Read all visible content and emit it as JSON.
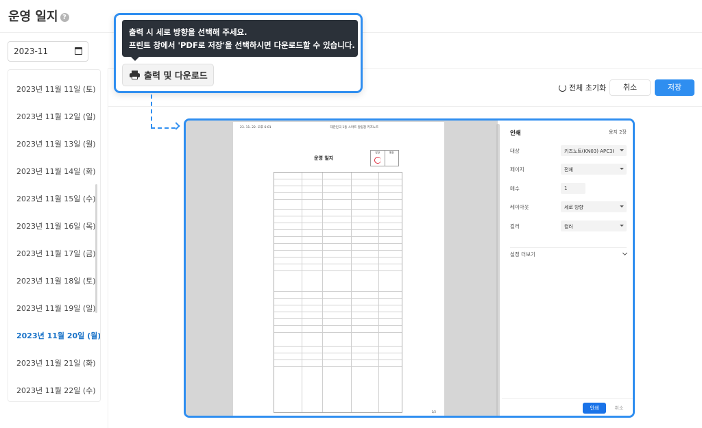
{
  "header": {
    "title": "운영 일지",
    "help_icon": "question-circle-icon"
  },
  "month_picker": {
    "value": "2023-11",
    "icon": "calendar-icon"
  },
  "date_list": {
    "items": [
      "2023년 11월 11일 (토)",
      "2023년 11월 12일 (일)",
      "2023년 11월 13일 (월)",
      "2023년 11월 14일 (화)",
      "2023년 11월 15일 (수)",
      "2023년 11월 16일 (목)",
      "2023년 11월 17일 (금)",
      "2023년 11월 18일 (토)",
      "2023년 11월 19일 (일)",
      "2023년 11월 20일 (월)",
      "2023년 11월 21일 (화)",
      "2023년 11월 22일 (수)"
    ],
    "active": "2023년 11월 20일 (월)"
  },
  "toolbar": {
    "reset_label": "전체 초기화",
    "cancel_label": "취소",
    "save_label": "저장"
  },
  "callout": {
    "tooltip_line1": "출력 시 세로 방향을 선택해 주세요.",
    "tooltip_line2": "프린트 창에서 'PDF로 저장'을 선택하시면 다운로드할 수 있습니다.",
    "print_button": "출력 및 다운로드"
  },
  "print_preview": {
    "sheet_header_left": "23. 11. 22. 오후 6:01",
    "sheet_header_center": "대한민국 1등 스마트 알림장 키즈노트",
    "sheet_title": "운영 일지",
    "stamp_cols": [
      "담당",
      "원장"
    ],
    "footer_page": "1/2",
    "panel": {
      "title": "인쇄",
      "pages": "용지 2장",
      "rows": [
        {
          "label": "대상",
          "value": "키즈노트(KN03) APC3I"
        },
        {
          "label": "페이지",
          "value": "전체"
        },
        {
          "label": "매수",
          "value": "1"
        },
        {
          "label": "레이아웃",
          "value": "세로 방향"
        },
        {
          "label": "컬러",
          "value": "컬러"
        }
      ],
      "more_settings": "설정 더보기",
      "print_button": "인쇄",
      "cancel_button": "취소"
    }
  },
  "colors": {
    "accent": "#2f8ef0",
    "active_text": "#1a73c8",
    "tooltip_bg": "#2b3139"
  }
}
